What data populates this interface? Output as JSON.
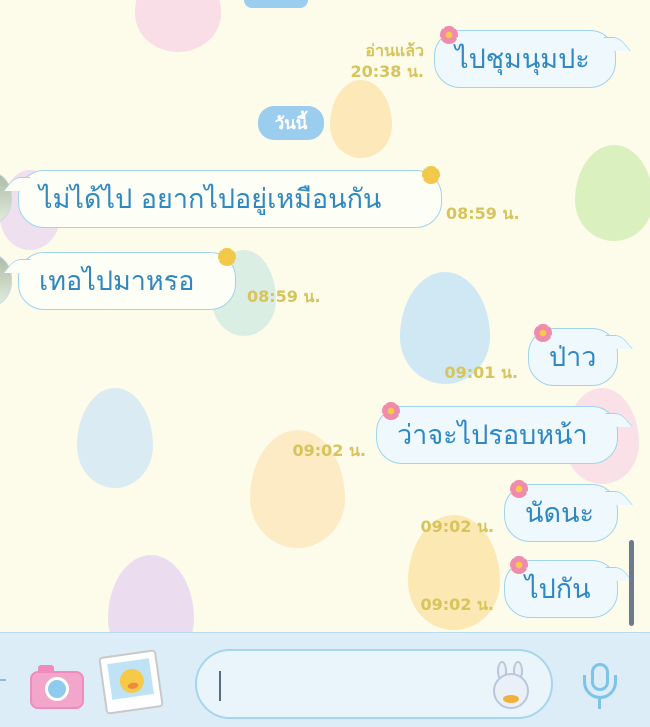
{
  "chat": {
    "top_read_label": "อ่านแล้ว",
    "top_time": "20:38 น.",
    "date_divider": "วันนี้",
    "messages": [
      {
        "direction": "sent",
        "text": "ไปชุมนุมปะ",
        "read": "อ่านแล้ว",
        "time": "20:38 น."
      },
      {
        "direction": "received",
        "text": "ไม่ได้ไป อยากไปอยู่เหมือนกัน",
        "time": "08:59 น."
      },
      {
        "direction": "received",
        "text": "เทอไปมาหรอ",
        "time": "08:59 น."
      },
      {
        "direction": "sent",
        "text": "ป่าว",
        "time": "09:01 น."
      },
      {
        "direction": "sent",
        "text": "ว่าจะไปรอบหน้า",
        "time": "09:02 น."
      },
      {
        "direction": "sent",
        "text": "นัดนะ",
        "time": "09:02 น."
      },
      {
        "direction": "sent",
        "text": "ไปกัน",
        "time": "09:02 น."
      }
    ]
  },
  "input_bar": {
    "message_placeholder": "",
    "icons": [
      "camera-icon",
      "gallery-icon",
      "emoji-sticker-icon",
      "microphone-icon"
    ]
  },
  "colors": {
    "background": "#fdfbea",
    "bubble_border": "#9fd3ee",
    "message_text": "#2f88c2",
    "timestamp": "#d7c45c",
    "date_pill": "#9bcdef",
    "input_bar": "#dcedf7"
  }
}
